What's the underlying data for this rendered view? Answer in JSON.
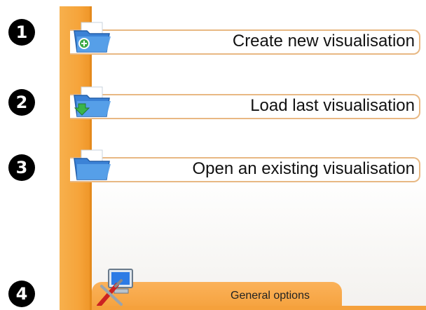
{
  "callouts": [
    "1",
    "2",
    "3",
    "4"
  ],
  "actions": [
    {
      "label": "Create new visualisation",
      "icon": "folder-add-icon"
    },
    {
      "label": "Load last visualisation",
      "icon": "folder-download-icon"
    },
    {
      "label": "Open an existing visualisation",
      "icon": "folder-open-icon"
    }
  ],
  "general_options": {
    "label": "General options",
    "icon": "tools-computer-icon"
  },
  "colors": {
    "rail": "#f6a43a",
    "border": "#e8b883",
    "folder": "#3b82d6"
  }
}
